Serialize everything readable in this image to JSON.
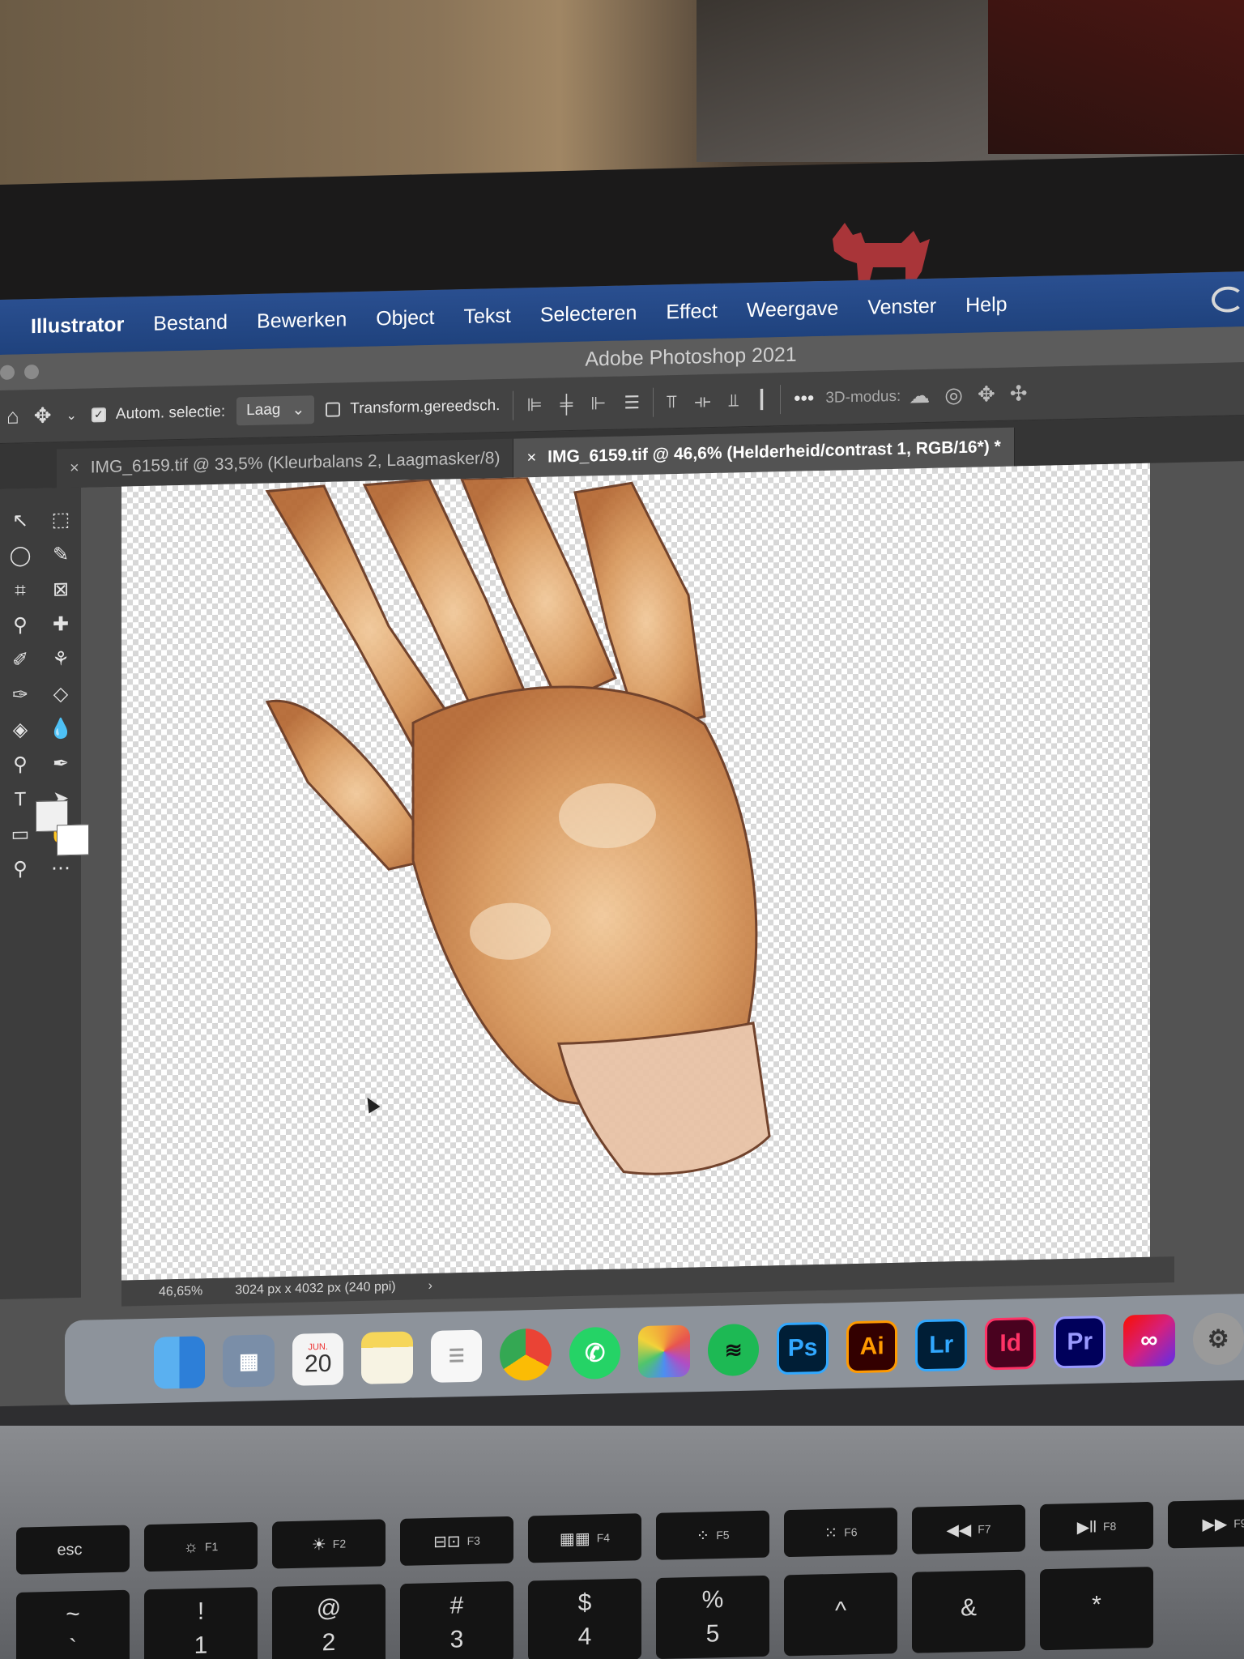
{
  "menubar": {
    "items": [
      "Illustrator",
      "Bestand",
      "Bewerken",
      "Object",
      "Tekst",
      "Selecteren",
      "Effect",
      "Weergave",
      "Venster",
      "Help"
    ]
  },
  "window": {
    "title": "Adobe Photoshop 2021"
  },
  "options": {
    "auto_select_label": "Autom. selectie:",
    "auto_select_checked": true,
    "layer_select_value": "Laag",
    "transform_label": "Transform.gereedsch.",
    "transform_checked": false,
    "threed_label": "3D-modus:",
    "more_label": "•••"
  },
  "tabs": [
    {
      "label": "IMG_6159.tif @ 33,5% (Kleurbalans 2, Laagmasker/8)",
      "active": false
    },
    {
      "label": "IMG_6159.tif @ 46,6% (Helderheid/contrast 1, RGB/16*) *",
      "active": true
    }
  ],
  "status": {
    "zoom": "46,65%",
    "doc_size": "3024 px x 4032 px (240 ppi)"
  },
  "dock": {
    "calendar_month": "JUN.",
    "calendar_day": "20",
    "apps": [
      {
        "name": "Ps",
        "bg": "#001e36",
        "fg": "#31a8ff"
      },
      {
        "name": "Ai",
        "bg": "#330000",
        "fg": "#ff9a00"
      },
      {
        "name": "Lr",
        "bg": "#001e36",
        "fg": "#31a8ff"
      },
      {
        "name": "Id",
        "bg": "#49021f",
        "fg": "#ff3366"
      },
      {
        "name": "Pr",
        "bg": "#00005b",
        "fg": "#9999ff"
      }
    ]
  },
  "keyboard": {
    "fn_row": [
      {
        "main": "esc",
        "sub": ""
      },
      {
        "main": "☼",
        "sub": "F1"
      },
      {
        "main": "☀",
        "sub": "F2"
      },
      {
        "main": "⊟⊡",
        "sub": "F3"
      },
      {
        "main": "▦▦",
        "sub": "F4"
      },
      {
        "main": "⁘",
        "sub": "F5"
      },
      {
        "main": "⁙",
        "sub": "F6"
      },
      {
        "main": "◀◀",
        "sub": "F7"
      },
      {
        "main": "▶ll",
        "sub": "F8"
      },
      {
        "main": "▶▶",
        "sub": "F9"
      }
    ],
    "num_row": [
      {
        "top": "~",
        "bottom": "`"
      },
      {
        "top": "!",
        "bottom": "1"
      },
      {
        "top": "@",
        "bottom": "2"
      },
      {
        "top": "#",
        "bottom": "3"
      },
      {
        "top": "$",
        "bottom": "4"
      },
      {
        "top": "%",
        "bottom": "5"
      },
      {
        "top": "^",
        "bottom": ""
      },
      {
        "top": "&",
        "bottom": ""
      },
      {
        "top": "*",
        "bottom": ""
      }
    ]
  }
}
